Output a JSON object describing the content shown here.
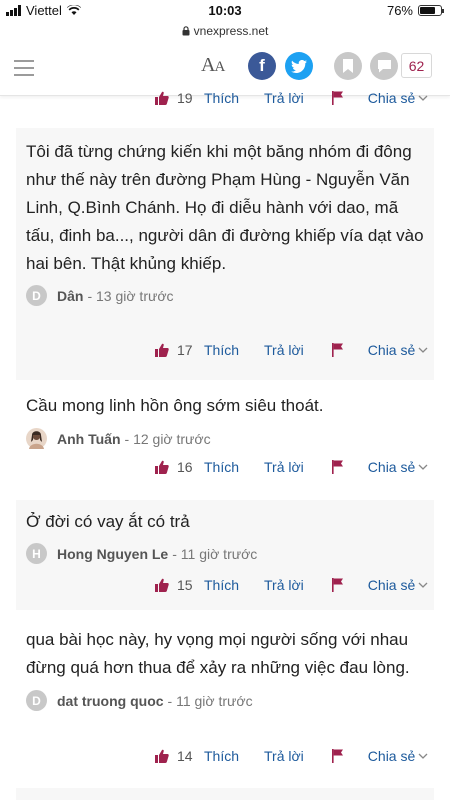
{
  "status_bar": {
    "carrier": "Viettel",
    "time": "10:03",
    "battery": "76%",
    "battery_level": 0.76
  },
  "url": "vnexpress.net",
  "header": {
    "font_size_label": "A",
    "font_size_label_small": "A",
    "comment_count": "62"
  },
  "top_actions": {
    "likes": "19",
    "like_label": "Thích",
    "reply_label": "Trả lời",
    "share_label": "Chia sẻ"
  },
  "comments": [
    {
      "text": "Tôi đã từng chứng kiến khi một băng nhóm đi đông như thế này trên đường Phạm Hùng - Nguyễn Văn Linh, Q.Bình Chánh. Họ đi diễu hành với dao, mã tấu, đinh ba..., người dân đi đường khiếp vía dạt vào hai bên. Thật khủng khiếp.",
      "avatar_letter": "D",
      "author": "Dân",
      "time": "- 13 giờ trước",
      "likes": "17",
      "like_label": "Thích",
      "reply_label": "Trả lời",
      "share_label": "Chia sẻ"
    },
    {
      "text": "Cầu mong linh hồn ông sớm siêu thoát.",
      "avatar_letter": "",
      "author": "Anh Tuấn",
      "time": "- 12 giờ trước",
      "likes": "16",
      "like_label": "Thích",
      "reply_label": "Trả lời",
      "share_label": "Chia sẻ"
    },
    {
      "text": "Ở đời có vay ắt có trả",
      "avatar_letter": "H",
      "author": "Hong Nguyen Le",
      "time": "- 11 giờ trước",
      "likes": "15",
      "like_label": "Thích",
      "reply_label": "Trả lời",
      "share_label": "Chia sẻ"
    },
    {
      "text": "qua bài học này, hy vọng mọi người sống với nhau đừng quá hơn thua để xảy ra những việc đau lòng.",
      "avatar_letter": "D",
      "author": "dat truong quoc",
      "time": "- 11 giờ trước",
      "likes": "14",
      "like_label": "Thích",
      "reply_label": "Trả lời",
      "share_label": "Chia sẻ"
    }
  ],
  "colors": {
    "accent": "#9f224e",
    "link": "#1d5a9c",
    "facebook": "#3b5998",
    "twitter": "#1da1f2"
  }
}
